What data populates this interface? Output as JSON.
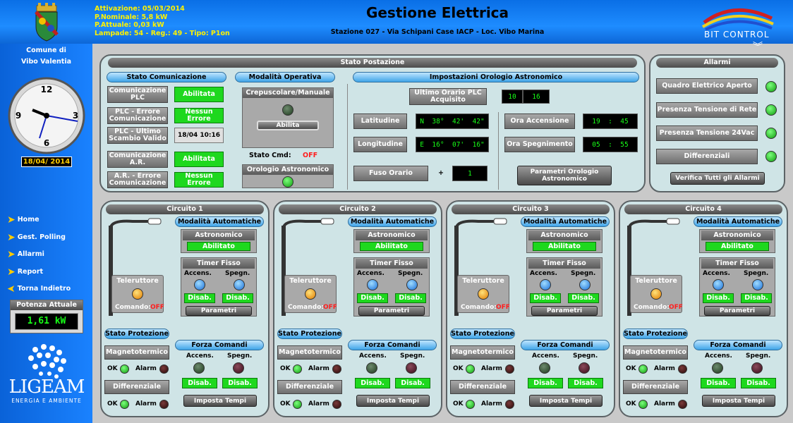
{
  "header": {
    "info": [
      "Attivazione: 05/03/2014",
      "P.Nominale: 5,8 kW",
      "P.Attuale: 0,03 kW",
      "Lampade: 54 - Reg.: 49 - Tipo: P1on"
    ],
    "title": "Gestione Elettrica",
    "subtitle": "Stazione 027 - Via Schipani Case IACP - Loc. Vibo Marina",
    "brand": "BIT CONTROL"
  },
  "sidebar": {
    "comune": "Comune di",
    "city": "Vibo Valentia",
    "date": "18/04/ 2014",
    "nav": [
      "Home",
      "Gest. Polling",
      "Allarmi",
      "Report",
      "Torna Indietro"
    ],
    "power_label": "Potenza Attuale",
    "power_value": "1,61 kW",
    "logo_text": "LIGEAM",
    "logo_sub": "ENERGIA E AMBIENTE"
  },
  "stato": {
    "title": "Stato Postazione",
    "comunicazione": {
      "title": "Stato Comunicazione",
      "rows": [
        {
          "label": "Comunicazione PLC",
          "value": "Abilitata"
        },
        {
          "label": "PLC - Errore Comunicazione",
          "value": "Nessun Errore"
        },
        {
          "label": "PLC - Ultimo Scambio Valido",
          "value": "18/04 10:16"
        },
        {
          "label": "Comunicazione A.R.",
          "value": "Abilitata"
        },
        {
          "label": "A.R. - Errore Comunicazione",
          "value": "Nessun Errore"
        }
      ]
    },
    "modalita": {
      "title": "Modalità Operativa",
      "crep": "Crepuscolare/Manuale",
      "abilita": "Abilita",
      "stato_cmd_label": "Stato Cmd:",
      "stato_cmd_value": "OFF",
      "orologio": "Orologio Astronomico"
    },
    "orologio": {
      "title": "Impostazioni Orologio Astronomico",
      "ultimo": "Ultimo Orario PLC Acquisito",
      "ultimo_h": "10",
      "ultimo_m": "16",
      "lat_label": "Latitudine",
      "lat_value": "N  38°  42'  42\"",
      "lon_label": "Longitudine",
      "lon_value": "E  16°  07'  16\"",
      "fuso_label": "Fuso Orario",
      "fuso_sign": "+",
      "fuso_value": "1",
      "acc_label": "Ora Accensione",
      "acc_value": "19  :  45",
      "spe_label": "Ora Spegnimento",
      "spe_value": "05  :  55",
      "parametri": "Parametri Orologio Astronomico"
    }
  },
  "allarmi": {
    "title": "Allarmi",
    "items": [
      "Quadro Elettrico Aperto",
      "Presenza Tensione di Rete",
      "Presenza Tensione 24Vac",
      "Differenziali"
    ],
    "verify": "Verifica Tutti gli Allarmi"
  },
  "circuits": [
    {
      "title": "Circuito 1"
    },
    {
      "title": "Circuito 2"
    },
    {
      "title": "Circuito 3"
    },
    {
      "title": "Circuito 4"
    }
  ],
  "circuit_labels": {
    "modalita": "Modalità Automatiche",
    "astronomico": "Astronomico",
    "abilitato": "Abilitato",
    "timer": "Timer Fisso",
    "accens": "Accens.",
    "spegn": "Spegn.",
    "disab": "Disab.",
    "parametri": "Parametri",
    "teleruttore": "Teleruttore",
    "comando_label": "Comando:",
    "comando_value": "OFF",
    "stato_prot": "Stato Protezione",
    "magneto": "Magnetotermico",
    "differenziale": "Differenziale",
    "ok": "OK",
    "alarm": "Alarm",
    "forza": "Forza Comandi",
    "imposta": "Imposta Tempi"
  },
  "colors": {
    "accent_blue": "#1e8cff",
    "led_green": "#19c519",
    "status_green": "#1ed81e",
    "lcd_text": "#17ff17"
  }
}
